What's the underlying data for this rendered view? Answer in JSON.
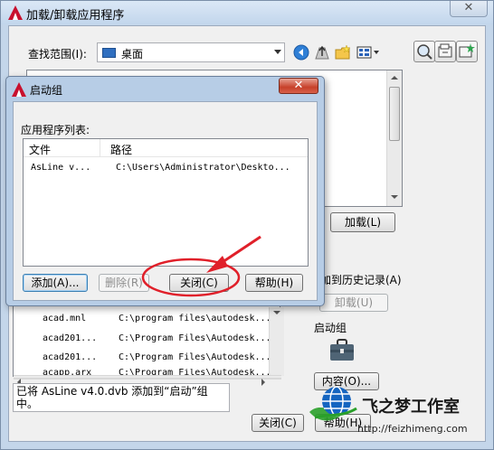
{
  "main_window": {
    "title": "加载/卸载应用程序",
    "close_glyph": "✕",
    "look_in_label": "查找范围(I):",
    "look_in_value": "桌面",
    "load_button": "加载(L)",
    "add_to_history_label": "加到历史记录(A)",
    "unload_button": "卸载(U)",
    "startup_group_label": "启动组",
    "contents_button": "内容(O)...",
    "status_text": "已将 AsLine v4.0.dvb 添加到“启动”组中。",
    "close_button": "关闭(C)",
    "help_button": "帮助(H)"
  },
  "history_list": {
    "rows": [
      {
        "file": "acad.mnl",
        "path": "C:\\program files\\autodesk..."
      },
      {
        "file": "acad201...",
        "path": "C:\\Program Files\\Autodesk..."
      },
      {
        "file": "acad201...",
        "path": "C:\\Program Files\\Autodesk..."
      },
      {
        "file": "acapp.arx",
        "path": "C:\\Program Files\\Autodesk..."
      }
    ]
  },
  "startup_dialog": {
    "title": "启动组",
    "close_glyph": "✕",
    "list_label": "应用程序列表:",
    "columns": [
      "文件",
      "路径"
    ],
    "rows": [
      {
        "file": "AsLine v...",
        "path": "C:\\Users\\Administrator\\Deskto..."
      }
    ],
    "add_button": "添加(A)...",
    "remove_button": "删除(R)",
    "close_button": "关闭(C)",
    "help_button": "帮助(H)"
  },
  "watermark": {
    "text": "飞之梦工作室",
    "url": "http://feizhimeng.com"
  },
  "icons": [
    "back-arrow-icon",
    "up-folder-icon",
    "new-folder-icon",
    "views-menu-icon",
    "find-icon",
    "locate-icon",
    "favorites-icon",
    "briefcase-icon",
    "desktop-icon",
    "globe-logo-icon"
  ],
  "colors": {
    "title_gradient_top": "#dbe8f6",
    "dialog_close": "#c7412a",
    "annotation_red": "#e0202a",
    "logo_green": "#2aa02a",
    "logo_blue": "#1565c0"
  }
}
